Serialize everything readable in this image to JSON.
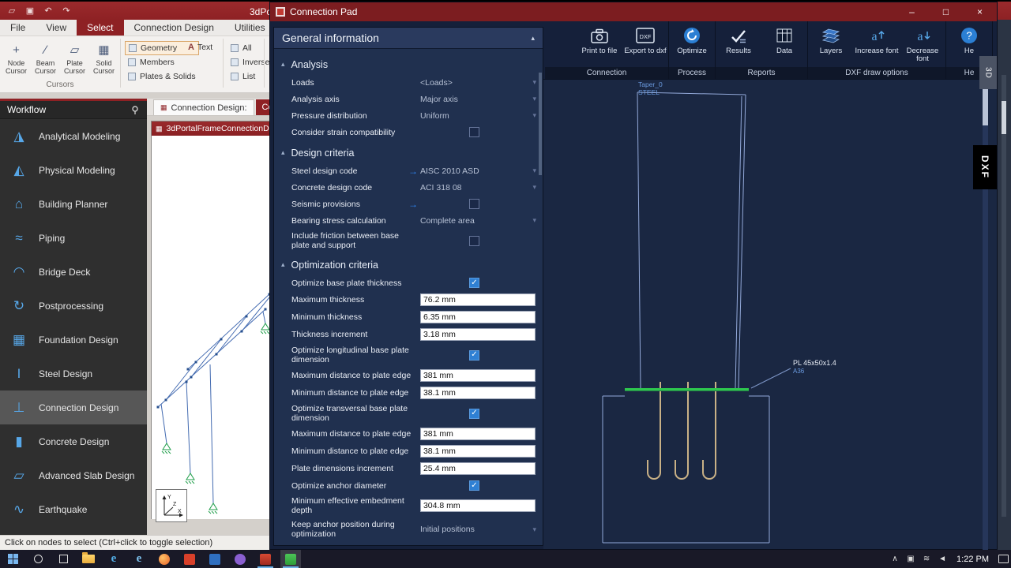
{
  "colors": {
    "accent_red": "#8e2124",
    "pad_title_red": "#7c1d20",
    "ribbon_navy": "#15203a",
    "panel_navy": "#20304f",
    "panel_header_navy": "#2a3a5e",
    "drawing_navy": "#1a2742",
    "check_blue": "#2f80d4",
    "line_blue": "#93a9d9",
    "plate_green": "#2ec84e",
    "anchor_tan": "#c9b186",
    "label_blue": "#6b9be0",
    "taskbar_bg": "#191927",
    "mdi_gray": "#d4d0cb",
    "ribbon_gray": "#f3f1ef",
    "workflow_bg": "#2f2f2f"
  },
  "app_window": {
    "title_fragment": "3dPo",
    "quick_icons": [
      "open-folder",
      "save",
      "undo",
      "redo"
    ],
    "menu_tabs": [
      "File",
      "View",
      "Select",
      "Connection Design",
      "Utilities"
    ],
    "active_tab": "Select",
    "cursor_buttons": [
      "Node Cursor",
      "Beam Cursor",
      "Plate Cursor",
      "Solid Cursor"
    ],
    "select_filters": [
      "Geometry",
      "Members",
      "Plates & Solids"
    ],
    "text_tool": "Text",
    "select_modes": [
      "All",
      "Inverse",
      "List"
    ],
    "cursors_group_label": "Cursors"
  },
  "workflow": {
    "title": "Workflow",
    "items": [
      "Analytical Modeling",
      "Physical Modeling",
      "Building Planner",
      "Piping",
      "Bridge Deck",
      "Postprocessing",
      "Foundation Design",
      "Steel Design",
      "Connection Design",
      "Concrete Design",
      "Advanced Slab Design",
      "Earthquake"
    ],
    "selected_item": "Connection Design"
  },
  "document_area": {
    "tab1": "Connection Design:",
    "tab2": "Co",
    "child_window_title": "3dPortalFrameConnectionD",
    "axis_labels": [
      "Y",
      "Z",
      "X"
    ]
  },
  "status_bar": {
    "text": "Click on nodes to select (Ctrl+click to toggle selection)"
  },
  "connection_pad": {
    "title": "Connection Pad",
    "window_buttons": [
      "minimize",
      "maximize",
      "close"
    ],
    "ribbon_groups": [
      {
        "label": "Connection",
        "buttons": [
          {
            "label": "Print to file",
            "icon": "camera"
          },
          {
            "label": "Export to dxf",
            "icon": "dxf"
          }
        ]
      },
      {
        "label": "Process",
        "buttons": [
          {
            "label": "Optimize",
            "icon": "optimize"
          }
        ]
      },
      {
        "label": "Reports",
        "buttons": [
          {
            "label": "Results",
            "icon": "results"
          },
          {
            "label": "Data",
            "icon": "data"
          }
        ]
      },
      {
        "label": "DXF draw options",
        "buttons": [
          {
            "label": "Layers",
            "icon": "layers"
          },
          {
            "label": "Increase font",
            "icon": "font-up"
          },
          {
            "label": "Decrease font",
            "icon": "font-down"
          }
        ]
      },
      {
        "label": "He",
        "buttons": [
          {
            "label": "He",
            "icon": "help"
          }
        ]
      }
    ],
    "general_info": {
      "header": "General information",
      "sections": [
        {
          "title": "Analysis",
          "rows": [
            {
              "label": "Loads",
              "type": "dropdown",
              "value": "<Loads>"
            },
            {
              "label": "Analysis axis",
              "type": "dropdown",
              "value": "Major axis"
            },
            {
              "label": "Pressure distribution",
              "type": "dropdown",
              "value": "Uniform"
            },
            {
              "label": "Consider strain compatibility",
              "type": "checkbox",
              "checked": false
            }
          ]
        },
        {
          "title": "Design criteria",
          "rows": [
            {
              "label": "Steel design code",
              "type": "dropdown",
              "value": "AISC 2010 ASD",
              "arrow": true
            },
            {
              "label": "Concrete design code",
              "type": "dropdown",
              "value": "ACI 318 08"
            },
            {
              "label": "Seismic provisions",
              "type": "checkbox",
              "checked": false,
              "arrow": true
            },
            {
              "label": "Bearing stress calculation",
              "type": "dropdown",
              "value": "Complete area"
            },
            {
              "label": "Include friction between base plate and support",
              "type": "checkbox",
              "checked": false
            }
          ]
        },
        {
          "title": "Optimization criteria",
          "rows": [
            {
              "label": "Optimize base plate thickness",
              "type": "checkbox",
              "checked": true
            },
            {
              "label": "Maximum thickness",
              "type": "input",
              "value": "76.2 mm"
            },
            {
              "label": "Minimum thickness",
              "type": "input",
              "value": "6.35 mm"
            },
            {
              "label": "Thickness increment",
              "type": "input",
              "value": "3.18 mm"
            },
            {
              "label": "Optimize longitudinal base plate dimension",
              "type": "checkbox",
              "checked": true
            },
            {
              "label": "Maximum distance to plate edge",
              "type": "input",
              "value": "381 mm"
            },
            {
              "label": "Minimum distance to plate edge",
              "type": "input",
              "value": "38.1 mm"
            },
            {
              "label": "Optimize transversal base plate dimension",
              "type": "checkbox",
              "checked": true
            },
            {
              "label": "Maximum distance to plate edge",
              "type": "input",
              "value": "381 mm"
            },
            {
              "label": "Minimum distance to plate edge",
              "type": "input",
              "value": "38.1 mm"
            },
            {
              "label": "Plate dimensions increment",
              "type": "input",
              "value": "25.4 mm"
            },
            {
              "label": "Optimize anchor diameter",
              "type": "checkbox",
              "checked": true
            },
            {
              "label": "Minimum effective embedment depth",
              "type": "input",
              "value": "304.8 mm"
            },
            {
              "label": "Keep anchor position during optimization",
              "type": "dropdown",
              "value": "Initial positions"
            }
          ]
        }
      ]
    },
    "drawing": {
      "member_label": "Taper_0",
      "member_material": "STEEL",
      "plate_label": "PL 45x50x1.4",
      "plate_grade": "A36",
      "tab_3d": "3D",
      "tab_dxf": "DXF"
    }
  },
  "taskbar": {
    "time": "1:22 PM",
    "icons": [
      "start",
      "search",
      "task-view",
      "file-explorer",
      "edge",
      "ie",
      "firefox",
      "red-app",
      "blue-app",
      "purple-app",
      "staad",
      "green-app"
    ],
    "tray": [
      "chevron-up",
      "tray-status",
      "tray-network",
      "tray-volume"
    ]
  }
}
